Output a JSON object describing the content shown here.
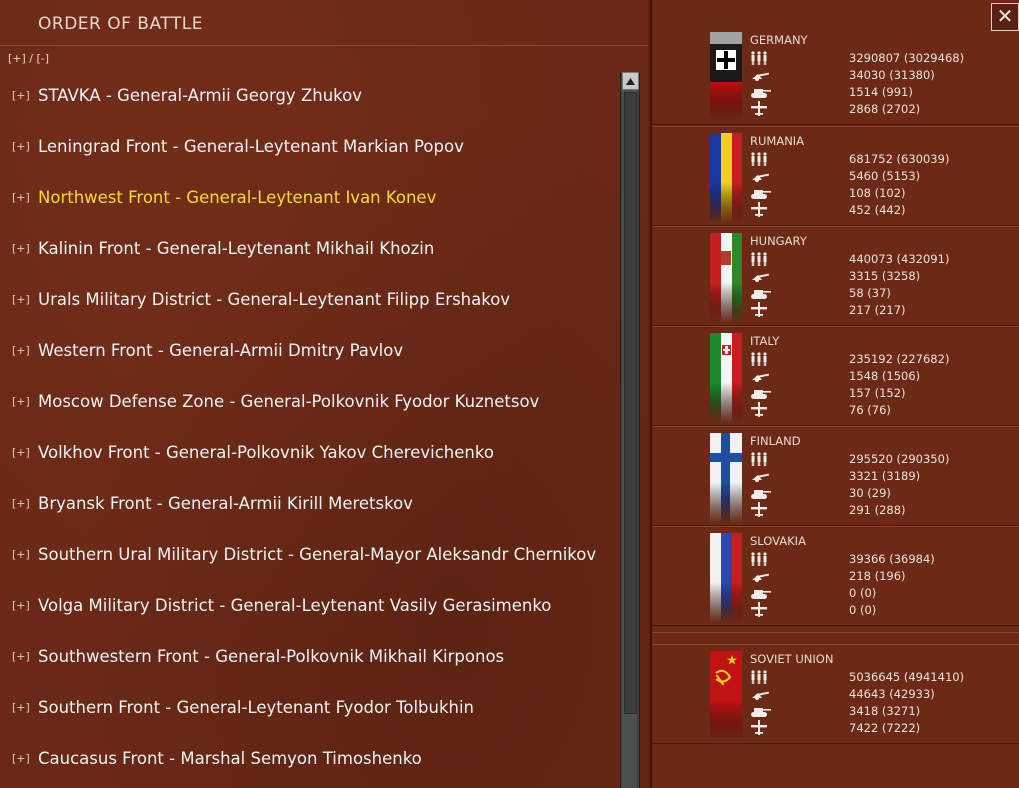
{
  "window": {
    "title": "ORDER OF BATTLE",
    "expand_all": "[+] / [-]",
    "close_glyph": "✕"
  },
  "oob": [
    {
      "expander": "[+]",
      "label": "STAVKA  -  General-Armii Georgy Zhukov",
      "selected": false
    },
    {
      "expander": "[+]",
      "label": "Leningrad Front  -  General-Leytenant Markian Popov",
      "selected": false
    },
    {
      "expander": "[+]",
      "label": "Northwest Front  -  General-Leytenant Ivan Konev",
      "selected": true
    },
    {
      "expander": "[+]",
      "label": "Kalinin Front  -  General-Leytenant Mikhail Khozin",
      "selected": false
    },
    {
      "expander": "[+]",
      "label": "Urals Military District  -  General-Leytenant Filipp Ershakov",
      "selected": false
    },
    {
      "expander": "[+]",
      "label": "Western Front  -  General-Armii Dmitry Pavlov",
      "selected": false
    },
    {
      "expander": "[+]",
      "label": "Moscow Defense Zone  -  General-Polkovnik Fyodor Kuznetsov",
      "selected": false
    },
    {
      "expander": "[+]",
      "label": "Volkhov Front  -  General-Polkovnik Yakov Cherevichenko",
      "selected": false
    },
    {
      "expander": "[+]",
      "label": "Bryansk Front  -  General-Armii Kirill Meretskov",
      "selected": false
    },
    {
      "expander": "[+]",
      "label": "Southern Ural Military District  -  General-Mayor Aleksandr Chernikov",
      "selected": false
    },
    {
      "expander": "[+]",
      "label": "Volga Military District  -  General-Leytenant Vasily Gerasimenko",
      "selected": false
    },
    {
      "expander": "[+]",
      "label": "Southwestern Front  -  General-Polkovnik Mikhail Kirponos",
      "selected": false
    },
    {
      "expander": "[+]",
      "label": "Southern Front  -  General-Leytenant Fyodor Tolbukhin",
      "selected": false
    },
    {
      "expander": "[+]",
      "label": "Caucasus Front  -  Marshal Semyon Timoshenko",
      "selected": false
    }
  ],
  "stat_icons": [
    "infantry-icon",
    "artillery-icon",
    "tank-icon",
    "aircraft-icon"
  ],
  "nations": [
    {
      "name": "GERMANY",
      "flag": "germany-flag",
      "stats": [
        "3290807 (3029468)",
        "34030 (31380)",
        "1514 (991)",
        "2868 (2702)"
      ]
    },
    {
      "name": "RUMANIA",
      "flag": "rumania-flag",
      "stats": [
        "681752 (630039)",
        "5460 (5153)",
        "108 (102)",
        "452 (442)"
      ]
    },
    {
      "name": "HUNGARY",
      "flag": "hungary-flag",
      "stats": [
        "440073 (432091)",
        "3315 (3258)",
        "58 (37)",
        "217 (217)"
      ]
    },
    {
      "name": "ITALY",
      "flag": "italy-flag",
      "stats": [
        "235192 (227682)",
        "1548 (1506)",
        "157 (152)",
        "76 (76)"
      ]
    },
    {
      "name": "FINLAND",
      "flag": "finland-flag",
      "stats": [
        "295520 (290350)",
        "3321 (3189)",
        "30 (29)",
        "291 (288)"
      ]
    },
    {
      "name": "SLOVAKIA",
      "flag": "slovakia-flag",
      "stats": [
        "39366 (36984)",
        "218 (196)",
        "0 (0)",
        "0 (0)"
      ]
    },
    {
      "name": "SOVIET UNION",
      "flag": "soviet-flag",
      "stats": [
        "5036645 (4941410)",
        "44643 (42933)",
        "3418 (3271)",
        "7422 (7222)"
      ]
    }
  ],
  "colors": {
    "selected_text": "#f7dd27",
    "normal_text": "#eef3f7",
    "panel_bg": "#6a2916"
  }
}
